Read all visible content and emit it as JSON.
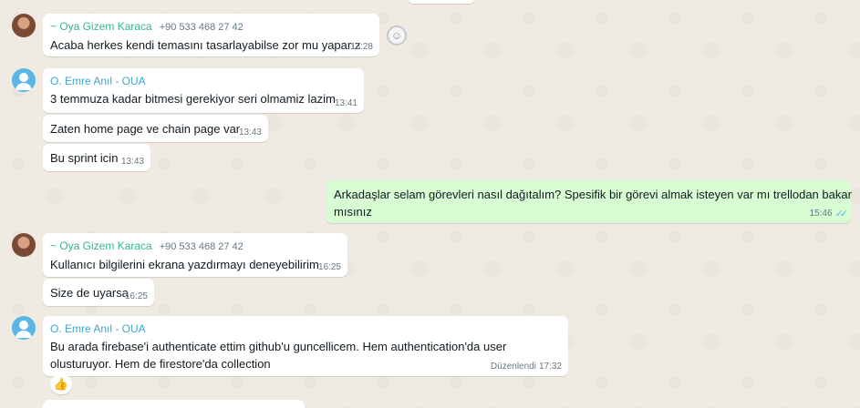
{
  "messages": [
    {
      "sender": "~ Oya Gizem Karaca",
      "phone": "+90 533 468 27 42",
      "text": "Acaba herkes kendi temasını tasarlayabilse zor mu yaparız",
      "time": "13:28"
    },
    {
      "sender": "O. Emre Anıl - OUA",
      "text": "3 temmuza kadar bitmesi gerekiyor seri olmamiz lazim",
      "time": "13:41"
    },
    {
      "text": "Zaten home page ve chain page var",
      "time": "13:43"
    },
    {
      "text": "Bu sprint icin",
      "time": "13:43"
    },
    {
      "text_line1": "Arkadaşlar selam görevleri nasıl dağıtalım? Spesifik bir görevi almak isteyen var mı trellodan bakar",
      "text_line2": "mısınız",
      "time": "15:46"
    },
    {
      "sender": "~ Oya Gizem Karaca",
      "phone": "+90 533 468 27 42",
      "text": "Kullanıcı bilgilerini ekrana yazdırmayı deneyebilirim",
      "time": "16:25"
    },
    {
      "text": "Size de uyarsa",
      "time": "16:25"
    },
    {
      "sender": "O. Emre Anıl - OUA",
      "text_line1": "Bu arada firebase'i authenticate ettim github'u guncellicem. Hem authentication'da user",
      "text_line2": "olusturuyor. Hem de firestore'da collection",
      "edited_label": "Düzenlendi",
      "time": "17:32",
      "reaction": "👍"
    }
  ],
  "colors": {
    "incoming": "#ffffff",
    "outgoing": "#d9fdd3",
    "sender_green": "#35b48c",
    "sender_blue": "#3fa4d6",
    "read_ticks": "#53bdeb"
  },
  "icons": {
    "react": "smiley-icon",
    "read": "double-check-icon"
  }
}
